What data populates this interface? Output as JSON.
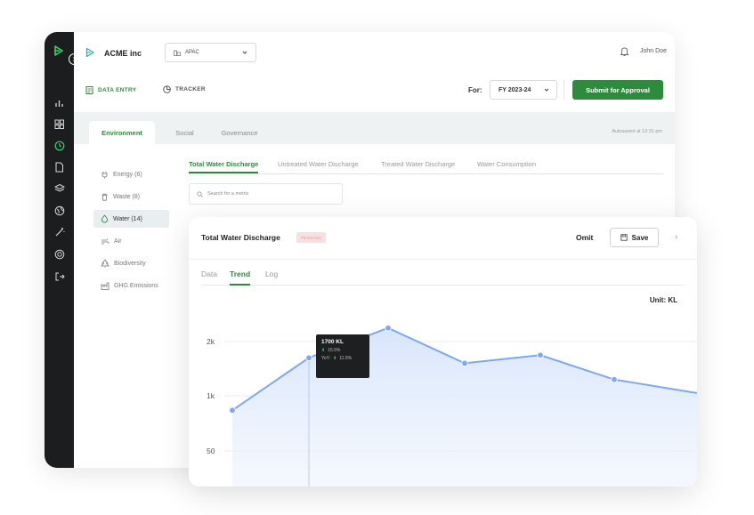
{
  "app": {
    "brand_name": "ACME inc"
  },
  "topbar": {
    "region": "APAC",
    "user_name": "John Doe"
  },
  "subbar": {
    "data_entry_label": "DATA ENTRY",
    "tracker_label": "TRACKER",
    "for_label": "For:",
    "fiscal_year": "FY 2023-24",
    "submit_label": "Submit for Approval"
  },
  "tabs": {
    "items": [
      "Environment",
      "Social",
      "Governance"
    ],
    "active": "Environment",
    "autosave": "Autosaved at 12:31 pm"
  },
  "categories": [
    {
      "label": "Energy (6)",
      "icon": "plug-icon"
    },
    {
      "label": "Waste (8)",
      "icon": "trash-icon"
    },
    {
      "label": "Water (14)",
      "icon": "water-drop-icon",
      "active": true
    },
    {
      "label": "Air",
      "icon": "wind-icon"
    },
    {
      "label": "Biodiversity",
      "icon": "tree-icon"
    },
    {
      "label": "GHG Emissions",
      "icon": "factory-icon"
    }
  ],
  "subtabs": {
    "items": [
      "Total Water Discharge",
      "Untreated Water Discharge",
      "Treated Water Discharge",
      "Water Consumption"
    ],
    "active": "Total Water Discharge"
  },
  "search": {
    "placeholder": "Search for a metric"
  },
  "card": {
    "title": "Total Water Discharge",
    "status": "PENDING",
    "omit_label": "Omit",
    "save_label": "Save",
    "view_tabs": [
      "Data",
      "Trend",
      "Log"
    ],
    "active_view": "Trend",
    "unit_label": "Unit: KL"
  },
  "tooltip": {
    "value": "1700 KL",
    "change": "15.5%",
    "yoy_label": "YoY:",
    "yoy_change": "11.5%"
  },
  "colors": {
    "accent_green": "#2e8b3e",
    "line_blue": "#7ea7ef",
    "area_blue": "#dbe7fb",
    "sidebar_dark": "#1b1d1f",
    "pending_bg": "#f8dfe0"
  },
  "chart_data": {
    "type": "area",
    "y_tick_labels": [
      "2k",
      "1k",
      "50"
    ],
    "y_tick_values": [
      2000,
      1000,
      50
    ],
    "x": [
      1,
      2,
      3,
      4,
      5,
      6,
      7
    ],
    "series": [
      {
        "values": [
          750,
          1700,
          2250,
          1600,
          1750,
          1300,
          1050
        ]
      }
    ],
    "highlight_index": 1,
    "grid": true
  }
}
